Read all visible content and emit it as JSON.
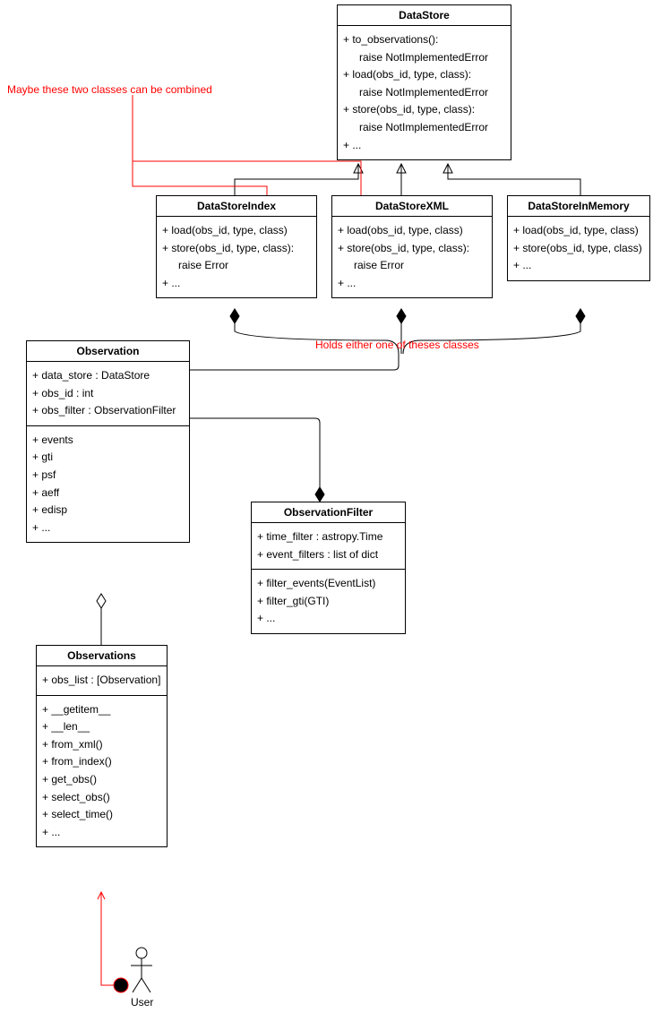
{
  "notes": {
    "combine": "Maybe these two classes can be combined",
    "holds": "Holds either one of theses classes"
  },
  "DataStore": {
    "title": "DataStore",
    "m1a": "+ to_observations():",
    "m1b": "raise NotImplementedError",
    "m2a": "+ load(obs_id, type, class):",
    "m2b": "raise NotImplementedError",
    "m3a": "+ store(obs_id, type, class):",
    "m3b": "raise NotImplementedError",
    "m4": "+ ..."
  },
  "DataStoreIndex": {
    "title": "DataStoreIndex",
    "m1": "+ load(obs_id, type, class)",
    "m2a": "+ store(obs_id, type, class):",
    "m2b": "raise Error",
    "m3": "+ ..."
  },
  "DataStoreXML": {
    "title": "DataStoreXML",
    "m1": "+ load(obs_id, type, class)",
    "m2a": "+ store(obs_id, type, class):",
    "m2b": "raise Error",
    "m3": "+ ..."
  },
  "DataStoreInMemory": {
    "title": "DataStoreInMemory",
    "m1": "+ load(obs_id, type, class)",
    "m2": "+ store(obs_id, type, class)",
    "m3": "+ ..."
  },
  "Observation": {
    "title": "Observation",
    "a1": "+ data_store : DataStore",
    "a2": "+ obs_id : int",
    "a3": "+ obs_filter : ObservationFilter",
    "m1": "+ events",
    "m2": "+ gti",
    "m3": "+ psf",
    "m4": "+ aeff",
    "m5": "+ edisp",
    "m6": "+ ..."
  },
  "ObservationFilter": {
    "title": "ObservationFilter",
    "a1": "+ time_filter : astropy.Time",
    "a2": "+ event_filters : list of dict",
    "m1": "+ filter_events(EventList)",
    "m2": "+ filter_gti(GTI)",
    "m3": "+ ..."
  },
  "Observations": {
    "title": "Observations",
    "a1": "+ obs_list : [Observation]",
    "m1": "+ __getitem__",
    "m2": "+ __len__",
    "m3": "+ from_xml()",
    "m4": "+ from_index()",
    "m5": "+ get_obs()",
    "m6": "+ select_obs()",
    "m7": "+ select_time()",
    "m8": "+ ..."
  },
  "actor": "User"
}
